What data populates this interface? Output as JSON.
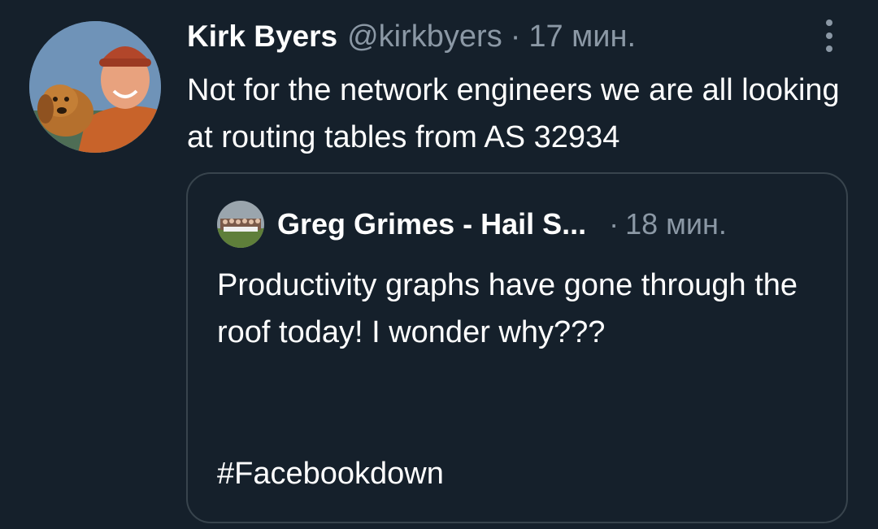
{
  "tweet": {
    "author_name": "Kirk Byers",
    "author_handle": "@kirkbyers",
    "separator": "·",
    "time": "17 мин.",
    "text": "Not for the network engineers we are all looking at routing tables from AS 32934",
    "more_icon": "more-vertical-icon"
  },
  "quote": {
    "author_name": "Greg Grimes - Hail S...",
    "separator": "·",
    "time": "18 мин.",
    "text": "Productivity graphs have gone through the roof today! I wonder why???",
    "hashtag": "#Facebookdown"
  },
  "colors": {
    "background": "#15202b",
    "secondary_text": "#8b98a5",
    "border": "#38444d"
  }
}
